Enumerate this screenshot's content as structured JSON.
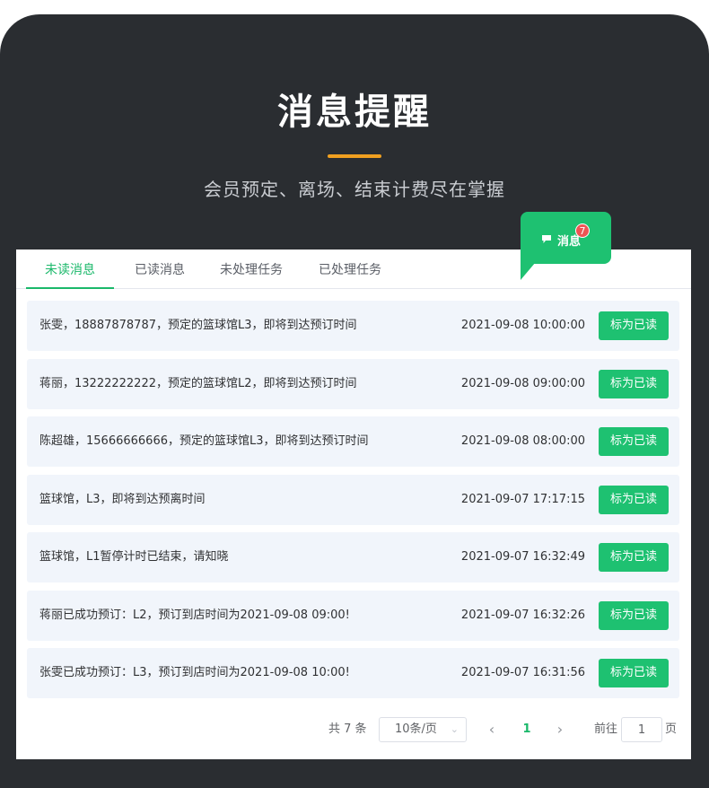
{
  "hero": {
    "title": "消息提醒",
    "subtitle": "会员预定、离场、结束计费尽在掌握"
  },
  "bubble": {
    "label": "消息",
    "badge": "7",
    "icon": "chat-icon"
  },
  "tabs": [
    {
      "label": "未读消息",
      "active": true
    },
    {
      "label": "已读消息",
      "active": false
    },
    {
      "label": "未处理任务",
      "active": false
    },
    {
      "label": "已处理任务",
      "active": false
    }
  ],
  "messages": [
    {
      "text": "张雯，18887878787，预定的篮球馆L3，即将到达预订时间",
      "time": "2021-09-08 10:00:00",
      "action": "标为已读"
    },
    {
      "text": "蒋丽，13222222222，预定的篮球馆L2，即将到达预订时间",
      "time": "2021-09-08 09:00:00",
      "action": "标为已读"
    },
    {
      "text": "陈超雄，15666666666，预定的篮球馆L3，即将到达预订时间",
      "time": "2021-09-08 08:00:00",
      "action": "标为已读"
    },
    {
      "text": "篮球馆，L3，即将到达预离时间",
      "time": "2021-09-07 17:17:15",
      "action": "标为已读"
    },
    {
      "text": "篮球馆，L1暂停计时已结束，请知晓",
      "time": "2021-09-07 16:32:49",
      "action": "标为已读"
    },
    {
      "text": "蒋丽已成功预订：L2，预订到店时间为2021-09-08 09:00!",
      "time": "2021-09-07 16:32:26",
      "action": "标为已读"
    },
    {
      "text": "张雯已成功预订：L3，预订到店时间为2021-09-08 10:00!",
      "time": "2021-09-07 16:31:56",
      "action": "标为已读"
    }
  ],
  "pagination": {
    "total_label": "共 7 条",
    "page_size": "10条/页",
    "current_page": "1",
    "goto_label": "前往",
    "goto_value": "1",
    "goto_suffix": "页"
  },
  "colors": {
    "accent": "#1ec171",
    "badge": "#f05454",
    "hero_bar": "#f0a020",
    "background": "#2a2d31"
  }
}
